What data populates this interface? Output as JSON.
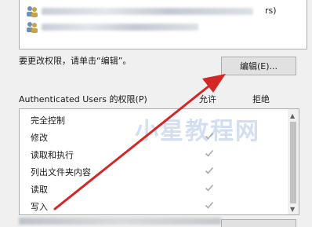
{
  "users": {
    "rows": [
      {
        "name_suffix": "rs)"
      },
      {
        "name_suffix": ""
      }
    ]
  },
  "hint_text": "要更改权限，请单击“编辑”。",
  "edit_button_label": "编辑(E)...",
  "permissions": {
    "label": "Authenticated Users 的权限(P)",
    "allow_header": "允许",
    "deny_header": "拒绝",
    "rows": [
      {
        "name": "完全控制",
        "allow": false
      },
      {
        "name": "修改",
        "allow": true
      },
      {
        "name": "读取和执行",
        "allow": true
      },
      {
        "name": "列出文件夹内容",
        "allow": true
      },
      {
        "name": "读取",
        "allow": true
      },
      {
        "name": "写入",
        "allow": true
      }
    ]
  },
  "watermark": "小星教程网",
  "colors": {
    "annotation_arrow": "#d32626",
    "check_gray": "#aaaaaa"
  }
}
